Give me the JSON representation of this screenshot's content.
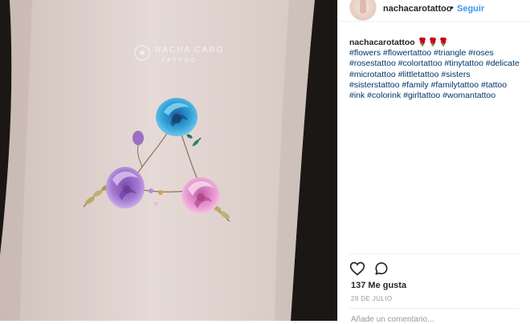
{
  "post": {
    "username": "nachacarotattoo",
    "follow_label": "Seguir",
    "separator": "•",
    "caption_user": "nachacarotattoo",
    "caption_emoji": "🌹🌹🌹",
    "hashtags": "#flowers #flowertattoo #triangle #roses #rosestattoo #colortattoo #tinytattoo #delicate #microtattoo #littletattoo #sisters #sisterstattoo #family #familytattoo #tattoo #ink #colorink #girltattoo #womantattoo",
    "likes": "137 Me gusta",
    "date": "28 DE JULIO",
    "comment_placeholder": "Añade un comentario..."
  },
  "photo": {
    "watermark_name": "NACHA CARO",
    "watermark_sub": "TATTOO"
  },
  "icons": {
    "like": "heart-icon",
    "comment": "comment-icon"
  },
  "colors": {
    "link": "#3897f0",
    "hashtag": "#003569",
    "text": "#262626",
    "muted": "#999999",
    "rose_blue": "#2f9fd6",
    "rose_purple": "#a57ad0",
    "rose_pink": "#e79ad0"
  }
}
